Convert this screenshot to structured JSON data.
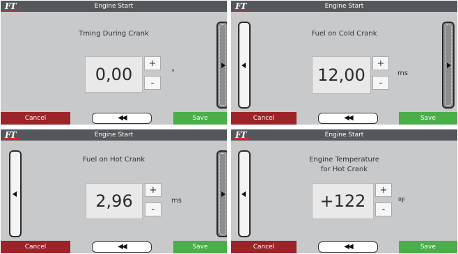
{
  "app": {
    "logo_text": "FT",
    "accent_color": "#d8262c",
    "cancel_color": "#9c2328",
    "save_color": "#4aae49"
  },
  "panels": [
    {
      "title": "Engine Start",
      "label": "Tming During Crank",
      "value": "0,00",
      "unit": "°",
      "plus": "+",
      "minus": "-",
      "cancel": "Cancel",
      "back": "◀◀",
      "save": "Save"
    },
    {
      "title": "Engine Start",
      "label": "Fuel on Cold Crank",
      "value": "12,00",
      "unit": "ms",
      "plus": "+",
      "minus": "-",
      "cancel": "Cancel",
      "back": "◀◀",
      "save": "Save"
    },
    {
      "title": "Engine Start",
      "label": "Fuel on Hot Crank",
      "value": "2,96",
      "unit": "ms",
      "plus": "+",
      "minus": "-",
      "cancel": "Cancel",
      "back": "◀◀",
      "save": "Save"
    },
    {
      "title": "Engine Start",
      "label_line1": "Engine Temperature",
      "label_line2": "for Hot Crank",
      "value": "+122",
      "unit": "ºF",
      "plus": "+",
      "minus": "-",
      "cancel": "Cancel",
      "back": "◀◀",
      "save": "Save"
    }
  ]
}
